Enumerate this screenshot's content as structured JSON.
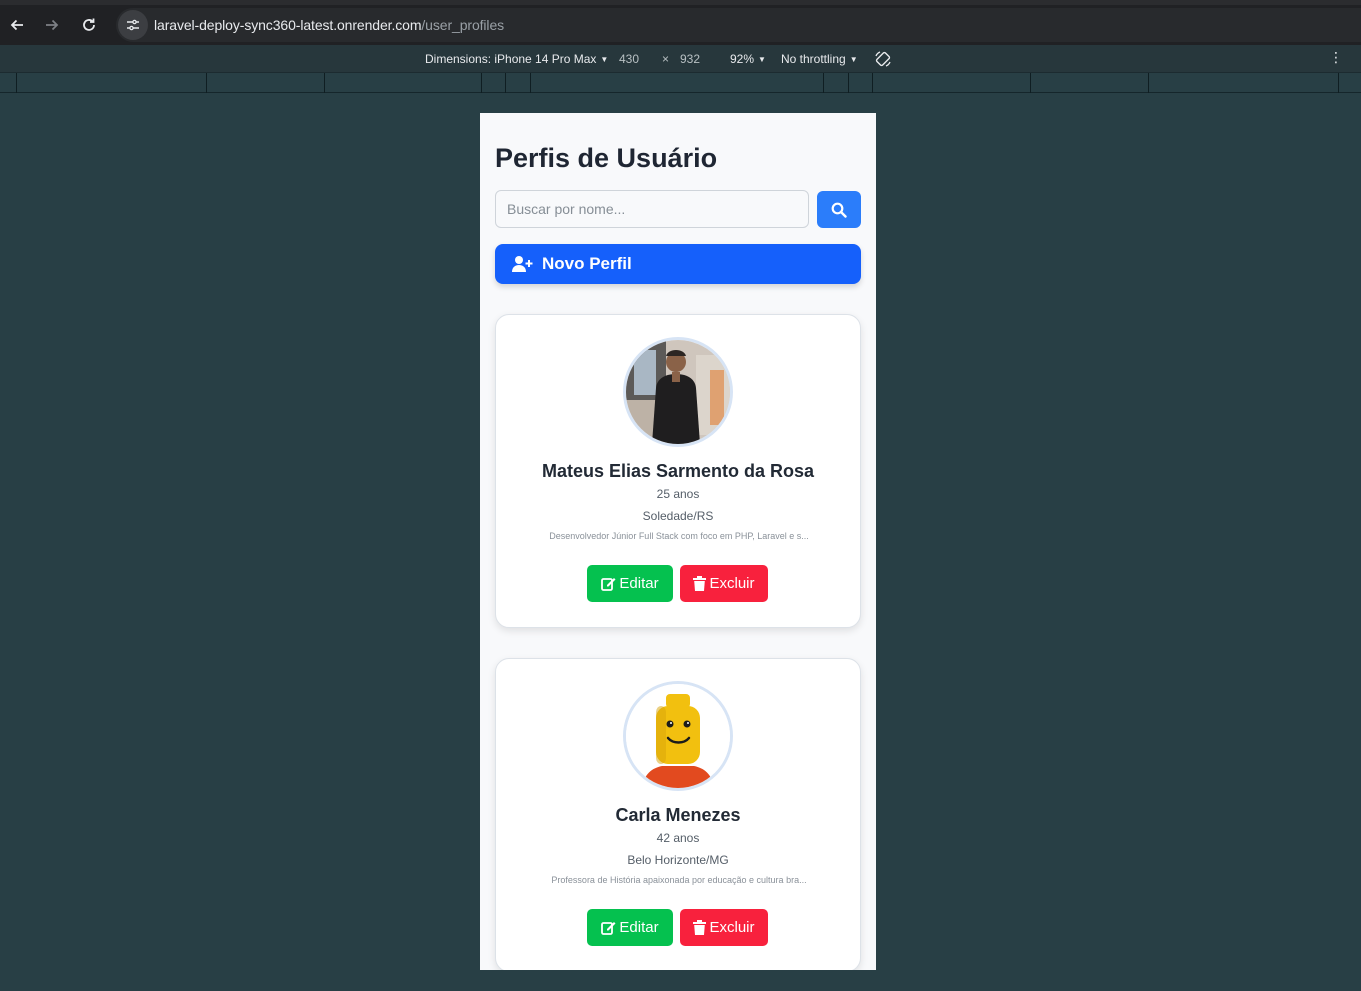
{
  "browser": {
    "url_domain": "laravel-deploy-sync360-latest.onrender.com",
    "url_path": "/user_profiles"
  },
  "devtools": {
    "dimensions_label": "Dimensions: iPhone 14 Pro Max",
    "width_value": "430",
    "times": "×",
    "height_value": "932",
    "zoom": "92%",
    "throttling": "No throttling"
  },
  "page": {
    "title": "Perfis de Usuário",
    "search_placeholder": "Buscar por nome...",
    "new_profile_label": "Novo Perfil"
  },
  "profiles": [
    {
      "name": "Mateus Elias Sarmento da Rosa",
      "age": "25 anos",
      "city": "Soledade/RS",
      "bio": "Desenvolvedor Júnior Full Stack com foco em PHP, Laravel e s...",
      "edit_label": "Editar",
      "delete_label": "Excluir"
    },
    {
      "name": "Carla Menezes",
      "age": "42 anos",
      "city": "Belo Horizonte/MG",
      "bio": "Professora de História apaixonada por educação e cultura bra...",
      "edit_label": "Editar",
      "delete_label": "Excluir"
    }
  ],
  "colors": {
    "primary": "#1560fb",
    "search_button": "#2b7dfa",
    "edit": "#05c14f",
    "delete": "#f8213d",
    "title": "#1f2633"
  }
}
